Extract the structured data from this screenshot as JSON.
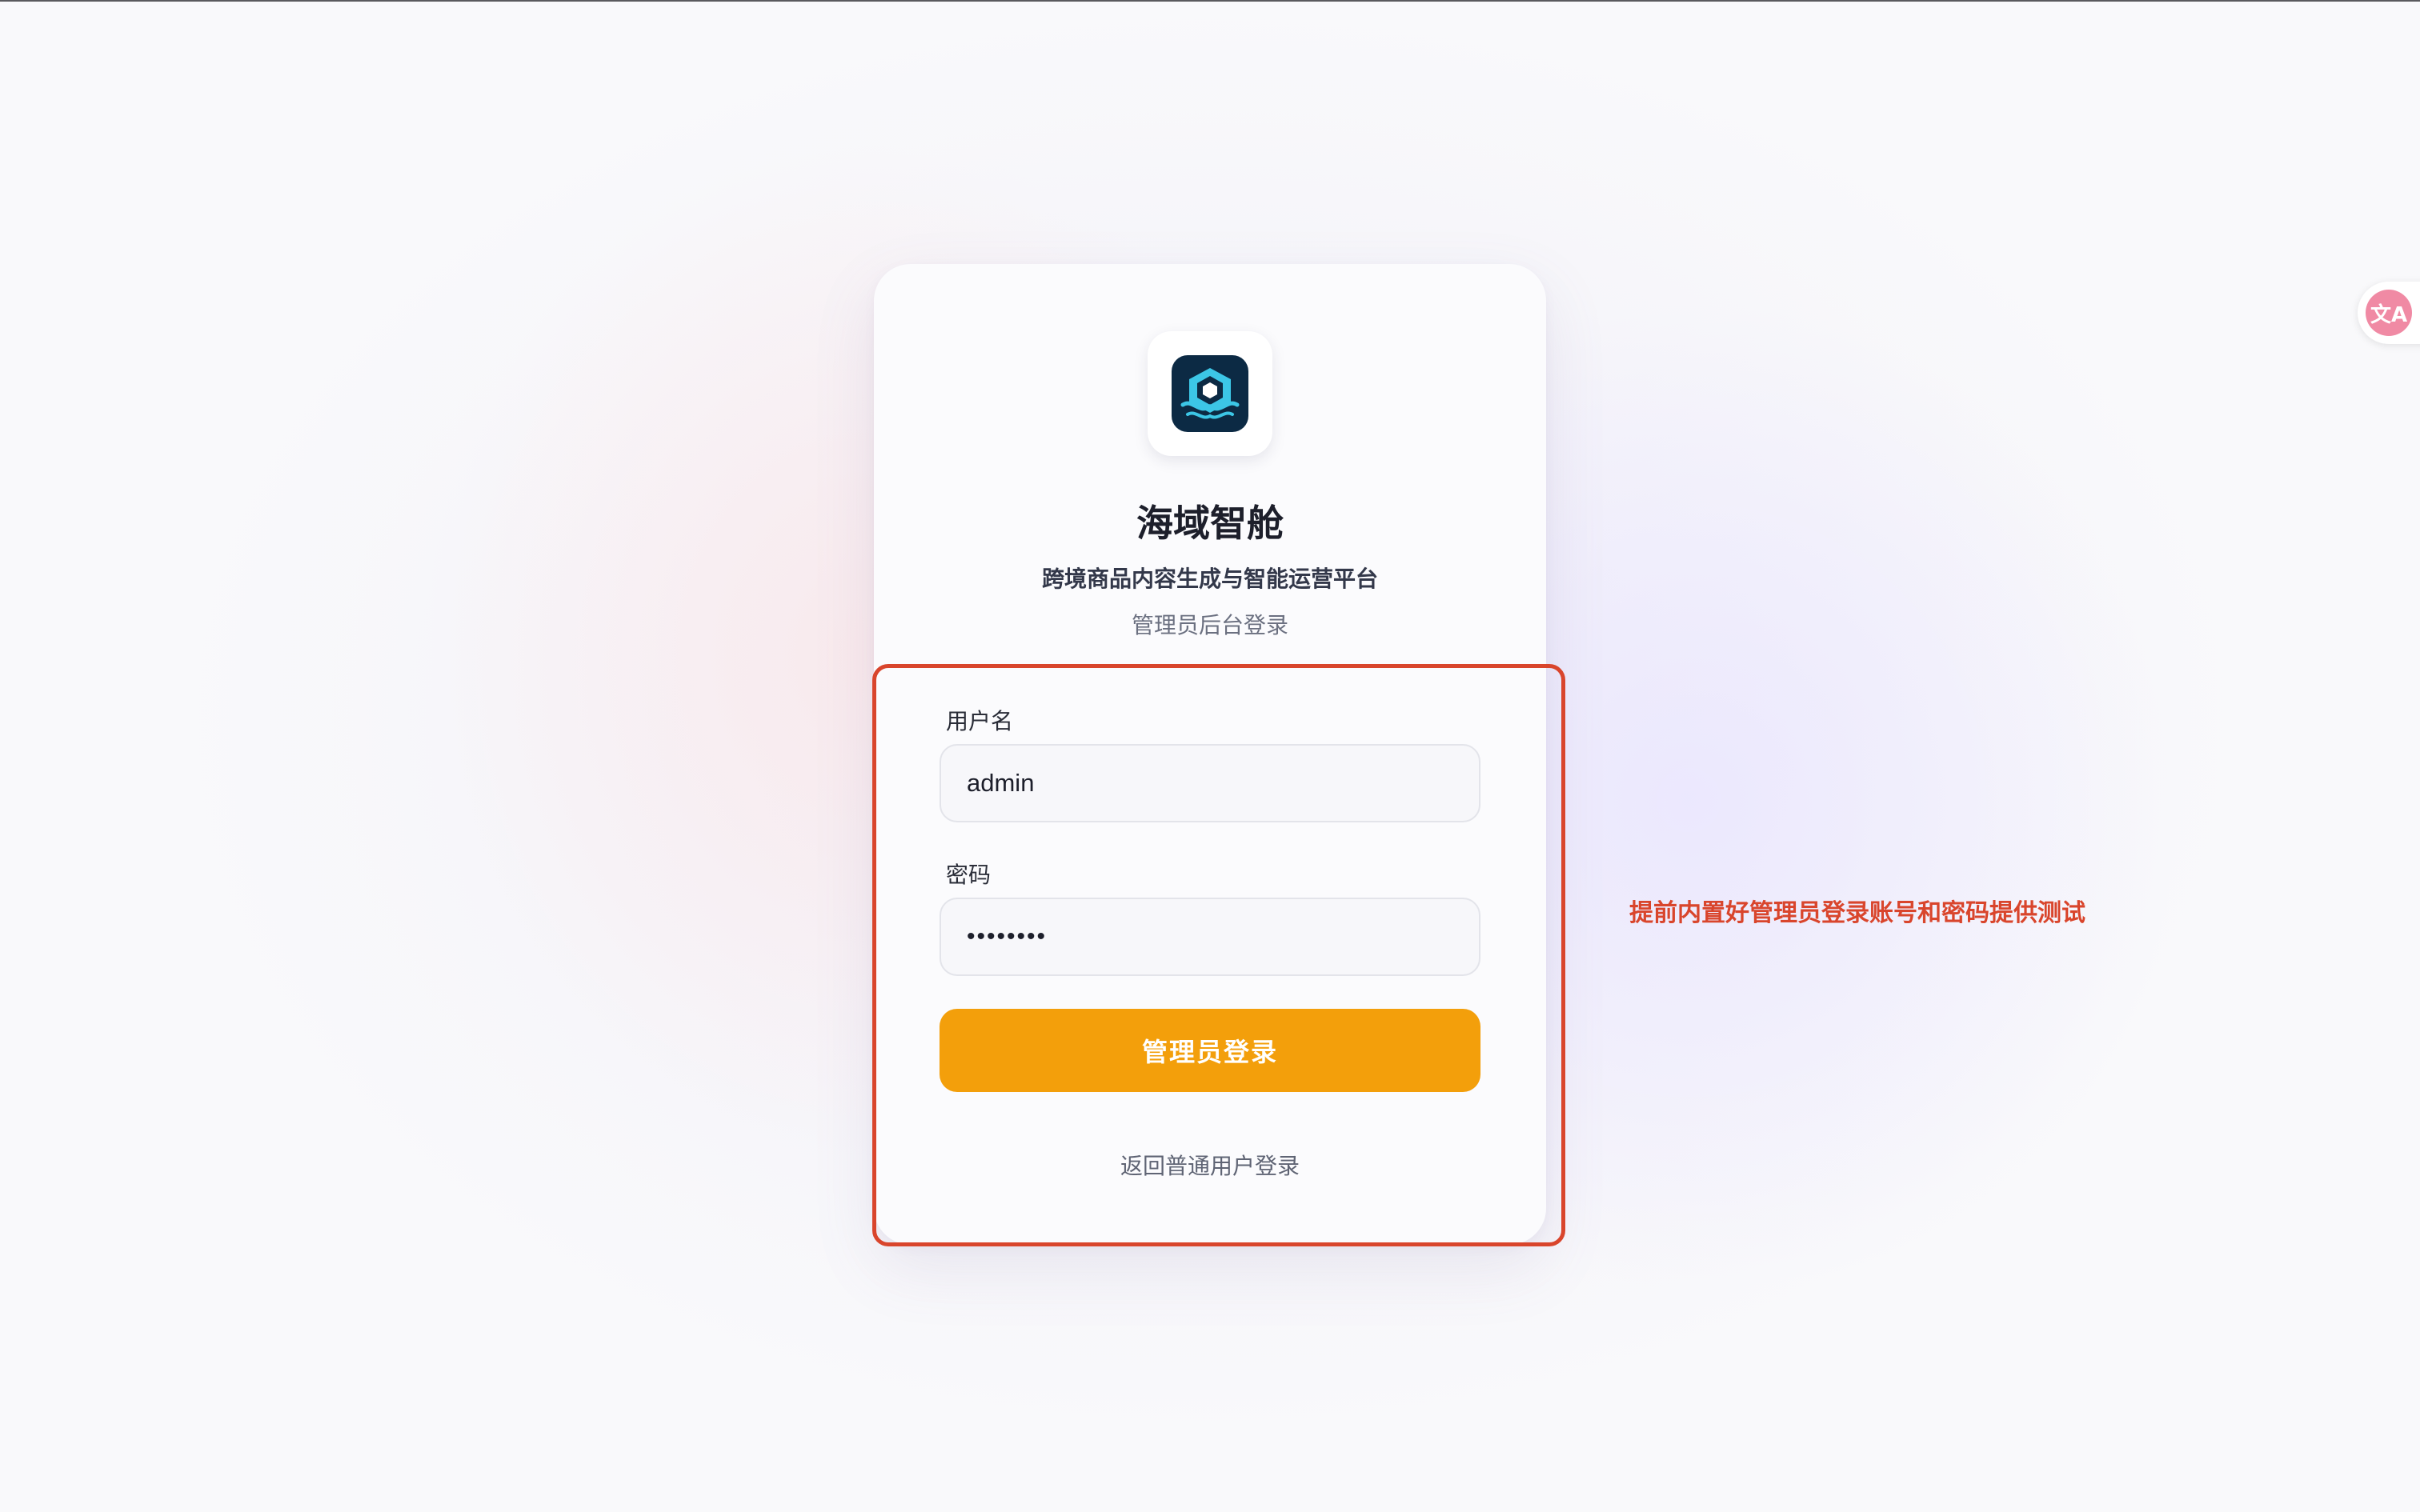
{
  "app": {
    "title": "海域智舱",
    "subtitle": "跨境商品内容生成与智能运营平台",
    "portal_label": "管理员后台登录",
    "logo_icon": "cube-waves-logo-icon"
  },
  "form": {
    "username_label": "用户名",
    "username_value": "admin",
    "password_label": "密码",
    "password_value": "••••••••",
    "submit_label": "管理员登录",
    "back_link": "返回普通用户登录"
  },
  "annotation": {
    "text": "提前内置好管理员登录账号和密码提供测试",
    "color": "#d9452c"
  },
  "translate_widget": {
    "icon": "translate-icon",
    "glyph": "文A"
  },
  "colors": {
    "accent": "#f39f0b",
    "annotation": "#d9452c",
    "logo_bg": "#0c2a44",
    "logo_cyan": "#3cc6e6"
  }
}
